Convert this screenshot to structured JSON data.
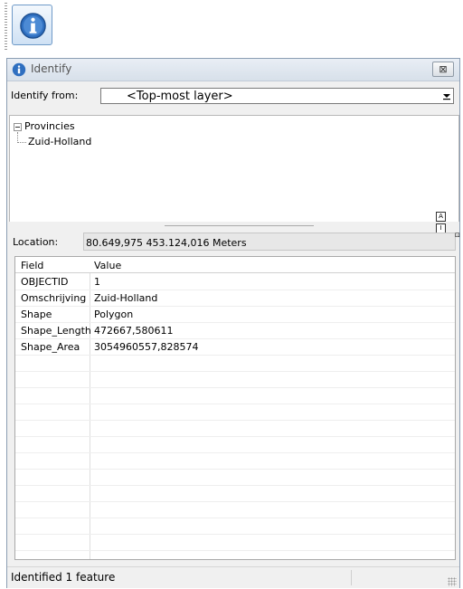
{
  "window": {
    "title": "Identify",
    "close_label": "⊠"
  },
  "identify_from": {
    "label": "Identify from:",
    "value": "<Top-most layer>"
  },
  "tree": {
    "layer": "Provincies",
    "feature": "Zuid-Holland"
  },
  "location": {
    "label": "Location:",
    "value": "80.649,975  453.124,016 Meters"
  },
  "grid": {
    "headers": [
      "Field",
      "Value"
    ],
    "rows": [
      [
        "OBJECTID",
        "1"
      ],
      [
        "Omschrijving",
        "Zuid-Holland"
      ],
      [
        "Shape",
        "Polygon"
      ],
      [
        "Shape_Length",
        "472667,580611"
      ],
      [
        "Shape_Area",
        "3054960557,828574"
      ]
    ]
  },
  "status": {
    "text": "Identified 1 feature"
  },
  "colors": {
    "accent": "#2f6fc0",
    "window_bg": "#f0f0f0",
    "border": "#8b9db3"
  },
  "icons": {
    "tool": "info-icon",
    "dropdown": "dropdown-arrow-icon"
  }
}
